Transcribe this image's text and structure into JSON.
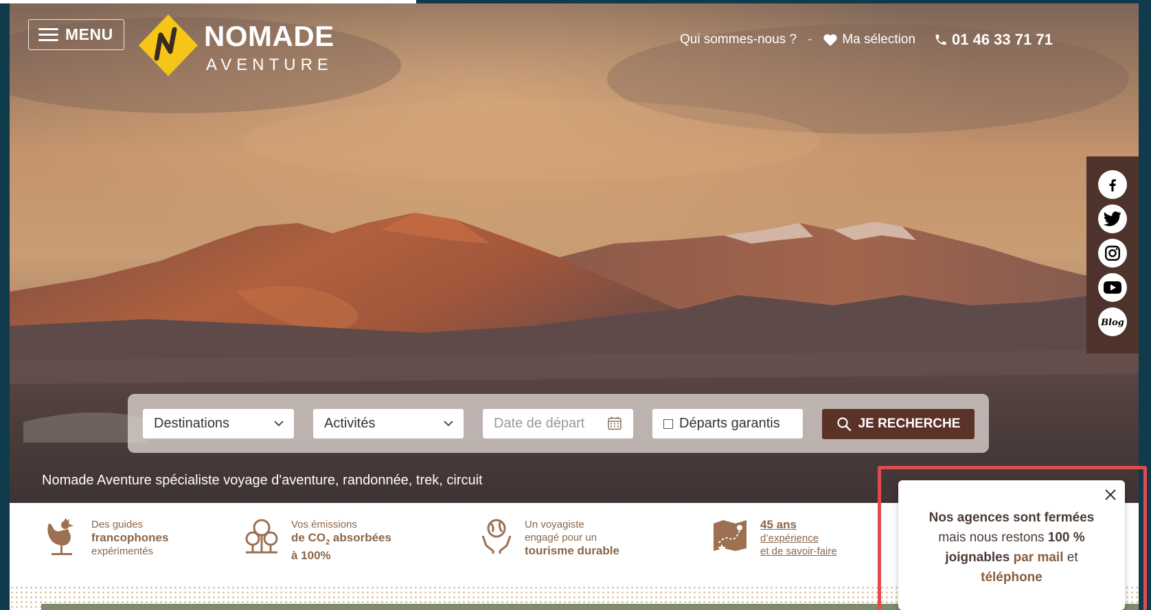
{
  "header": {
    "menu_label": "MENU",
    "logo_line1": "NOMADE",
    "logo_line2": "AVENTURE",
    "nav_who": "Qui sommes-nous ?",
    "nav_sep": "-",
    "nav_selection": "Ma sélection",
    "phone": "01 46 33 71 71"
  },
  "social": {
    "items": [
      {
        "name": "facebook-icon",
        "glyph": "f"
      },
      {
        "name": "twitter-icon"
      },
      {
        "name": "instagram-icon"
      },
      {
        "name": "youtube-icon"
      },
      {
        "name": "blog-icon",
        "label": "Blog"
      }
    ]
  },
  "search": {
    "destinations": "Destinations",
    "activities": "Activités",
    "date_placeholder": "Date de départ",
    "guaranteed": "Départs garantis",
    "button": "JE RECHERCHE"
  },
  "tagline": "Nomade Aventure spécialiste voyage d'aventure, randonnée, trek, circuit",
  "features": [
    {
      "line1": "Des guides",
      "line2": "francophones",
      "line3": "expérimentés"
    },
    {
      "line1": "Vos émissions",
      "line2a": "de CO",
      "sub": "2",
      "line2b": " absorbées",
      "line3": "à 100%"
    },
    {
      "line1": "Un voyagiste",
      "line2": "engagé pour un",
      "line3": "tourisme durable"
    },
    {
      "line1": "45 ans",
      "line2": "d’expérience",
      "line3": "et de savoir-faire"
    }
  ],
  "popup": {
    "line1": "Nos agences sont fermées",
    "line2a": "mais nous restons ",
    "line2b": "100 %",
    "line3a": "joignables",
    "line3b": "par mail",
    "line3c": "et",
    "line4": "téléphone"
  },
  "colors": {
    "brand_brown": "#5a3228",
    "logo_yellow": "#f5c518",
    "highlight_red": "#e34a4f",
    "feature_text": "#8a6648"
  }
}
